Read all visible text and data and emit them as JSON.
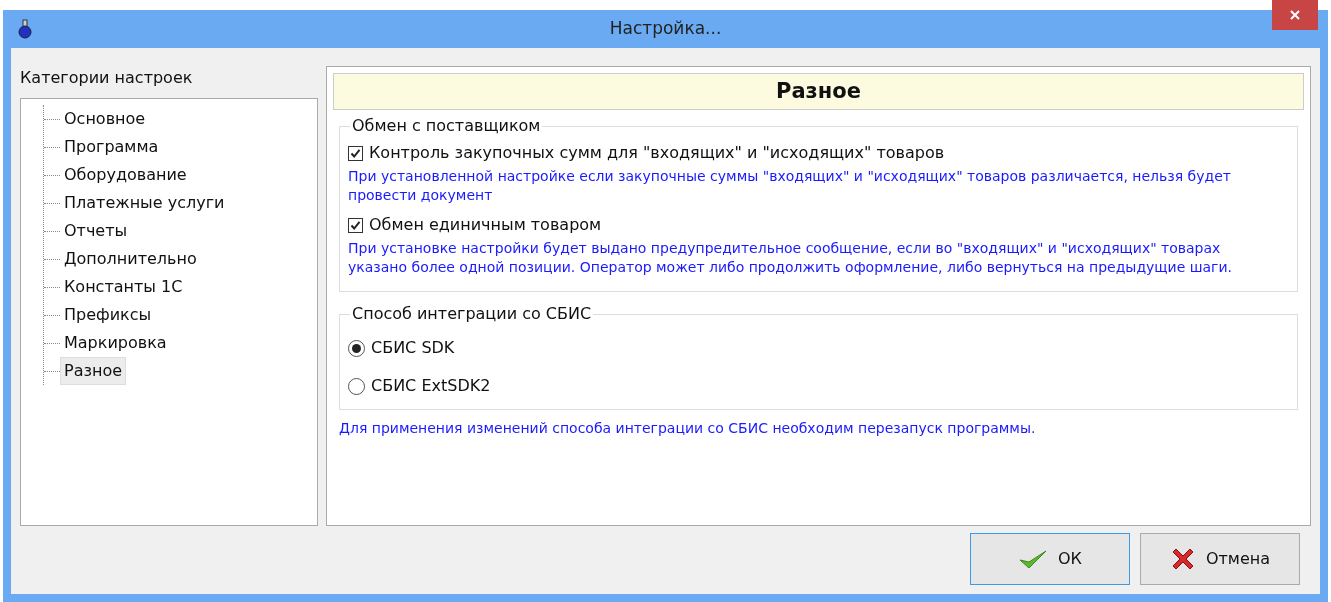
{
  "window": {
    "title": "Настройка..."
  },
  "sidebar": {
    "title": "Категории настроек",
    "items": [
      {
        "label": "Основное",
        "selected": false
      },
      {
        "label": "Программа",
        "selected": false
      },
      {
        "label": "Оборудование",
        "selected": false
      },
      {
        "label": "Платежные услуги",
        "selected": false
      },
      {
        "label": "Отчеты",
        "selected": false
      },
      {
        "label": "Дополнительно",
        "selected": false
      },
      {
        "label": "Константы 1С",
        "selected": false
      },
      {
        "label": "Префиксы",
        "selected": false
      },
      {
        "label": "Маркировка",
        "selected": false
      },
      {
        "label": "Разное",
        "selected": true
      }
    ]
  },
  "panel": {
    "title": "Разное",
    "exchange": {
      "legend": "Обмен с поставщиком",
      "options": [
        {
          "label": "Контроль закупочных сумм для \"входящих\" и \"исходящих\" товаров",
          "checked": true,
          "hint": "При установленной настройке если закупочные суммы \"входящих\" и \"исходящих\" товаров различается, нельзя будет провести документ"
        },
        {
          "label": "Обмен единичным товаром",
          "checked": true,
          "hint": "При установке настройки будет выдано предупредительное сообщение, если во \"входящих\" и \"исходящих\" товарах указано более одной позиции. Оператор может либо продолжить оформление, либо вернуться на предыдущие шаги."
        }
      ]
    },
    "integration": {
      "legend": "Способ интеграции со СБИС",
      "options": [
        {
          "label": "СБИС SDK",
          "selected": true
        },
        {
          "label": "СБИС ExtSDK2",
          "selected": false
        }
      ]
    },
    "note": "Для применения изменений способа интеграции со СБИС необходим перезапуск программы."
  },
  "buttons": [
    {
      "kind": "ok",
      "label": "ОК"
    },
    {
      "kind": "cancel",
      "label": "Отмена"
    }
  ]
}
